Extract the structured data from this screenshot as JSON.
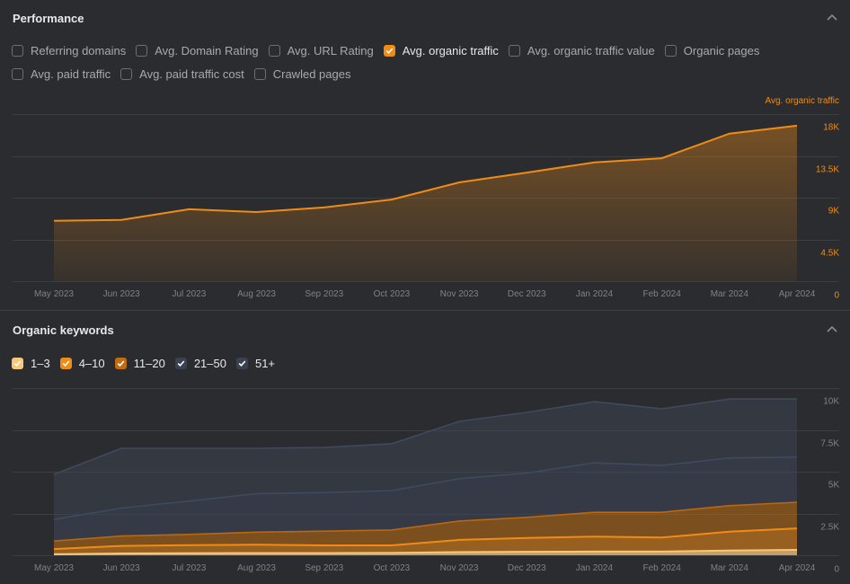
{
  "performance": {
    "title": "Performance",
    "collapse_icon": "chevron-up-icon",
    "metrics": [
      {
        "label": "Referring domains",
        "checked": false
      },
      {
        "label": "Avg. Domain Rating",
        "checked": false
      },
      {
        "label": "Avg. URL Rating",
        "checked": false
      },
      {
        "label": "Avg. organic traffic",
        "checked": true,
        "color": "#f08c14"
      },
      {
        "label": "Avg. organic traffic value",
        "checked": false
      },
      {
        "label": "Organic pages",
        "checked": false
      },
      {
        "label": "Avg. paid traffic",
        "checked": false
      },
      {
        "label": "Avg. paid traffic cost",
        "checked": false
      },
      {
        "label": "Crawled pages",
        "checked": false
      }
    ]
  },
  "keywords": {
    "title": "Organic keywords",
    "collapse_icon": "chevron-up-icon",
    "filters": [
      {
        "label": "1–3",
        "checked": true,
        "color": "#f7c77a"
      },
      {
        "label": "4–10",
        "checked": true,
        "color": "#f08c14"
      },
      {
        "label": "11–20",
        "checked": true,
        "color": "#c06d12"
      },
      {
        "label": "21–50",
        "checked": true,
        "color": "#3a4252"
      },
      {
        "label": "51+",
        "checked": true,
        "color": "#3a4252"
      }
    ]
  },
  "chart_data": [
    {
      "type": "area",
      "title": "Performance",
      "series_label": "Avg. organic traffic",
      "axis_side": "right",
      "axis_color": "#f08c14",
      "x": [
        "May 2023",
        "Jun 2023",
        "Jul 2023",
        "Aug 2023",
        "Sep 2023",
        "Oct 2023",
        "Nov 2023",
        "Dec 2023",
        "Jan 2024",
        "Feb 2024",
        "Mar 2024",
        "Apr 2024"
      ],
      "series": [
        {
          "name": "Avg. organic traffic",
          "color": "#f08c14",
          "values": [
            6500,
            6600,
            7750,
            7450,
            7950,
            8800,
            10650,
            11700,
            12800,
            13250,
            15900,
            16750
          ]
        }
      ],
      "yticks": [
        "0",
        "4.5K",
        "9K",
        "13.5K",
        "18K"
      ],
      "ylim": [
        0,
        18000
      ],
      "grid": true
    },
    {
      "type": "area",
      "stacked": true,
      "title": "Organic keywords",
      "axis_side": "right",
      "x": [
        "May 2023",
        "Jun 2023",
        "Jul 2023",
        "Aug 2023",
        "Sep 2023",
        "Oct 2023",
        "Nov 2023",
        "Dec 2023",
        "Jan 2024",
        "Feb 2024",
        "Mar 2024",
        "Apr 2024"
      ],
      "series": [
        {
          "name": "1–3",
          "color": "#f7c77a",
          "values": [
            60,
            110,
            120,
            130,
            130,
            140,
            190,
            210,
            220,
            220,
            280,
            320
          ]
        },
        {
          "name": "4–10",
          "color": "#f08c14",
          "values": [
            310,
            450,
            480,
            500,
            460,
            450,
            730,
            830,
            900,
            840,
            1130,
            1290
          ]
        },
        {
          "name": "11–20",
          "color": "#c06d12",
          "values": [
            480,
            590,
            650,
            750,
            850,
            920,
            1130,
            1230,
            1450,
            1510,
            1560,
            1560
          ]
        },
        {
          "name": "21–50",
          "color": "#3e4759",
          "values": [
            1290,
            1670,
            1990,
            2310,
            2310,
            2360,
            2530,
            2650,
            2960,
            2800,
            2850,
            2700
          ]
        },
        {
          "name": "51+",
          "color": "#3e4759",
          "values": [
            2700,
            3580,
            3160,
            2710,
            2700,
            2800,
            3430,
            3630,
            3660,
            3390,
            3530,
            3480
          ]
        }
      ],
      "yticks": [
        "0",
        "2.5K",
        "5K",
        "7.5K",
        "10K"
      ],
      "ylim": [
        0,
        10000
      ],
      "grid": true
    }
  ]
}
